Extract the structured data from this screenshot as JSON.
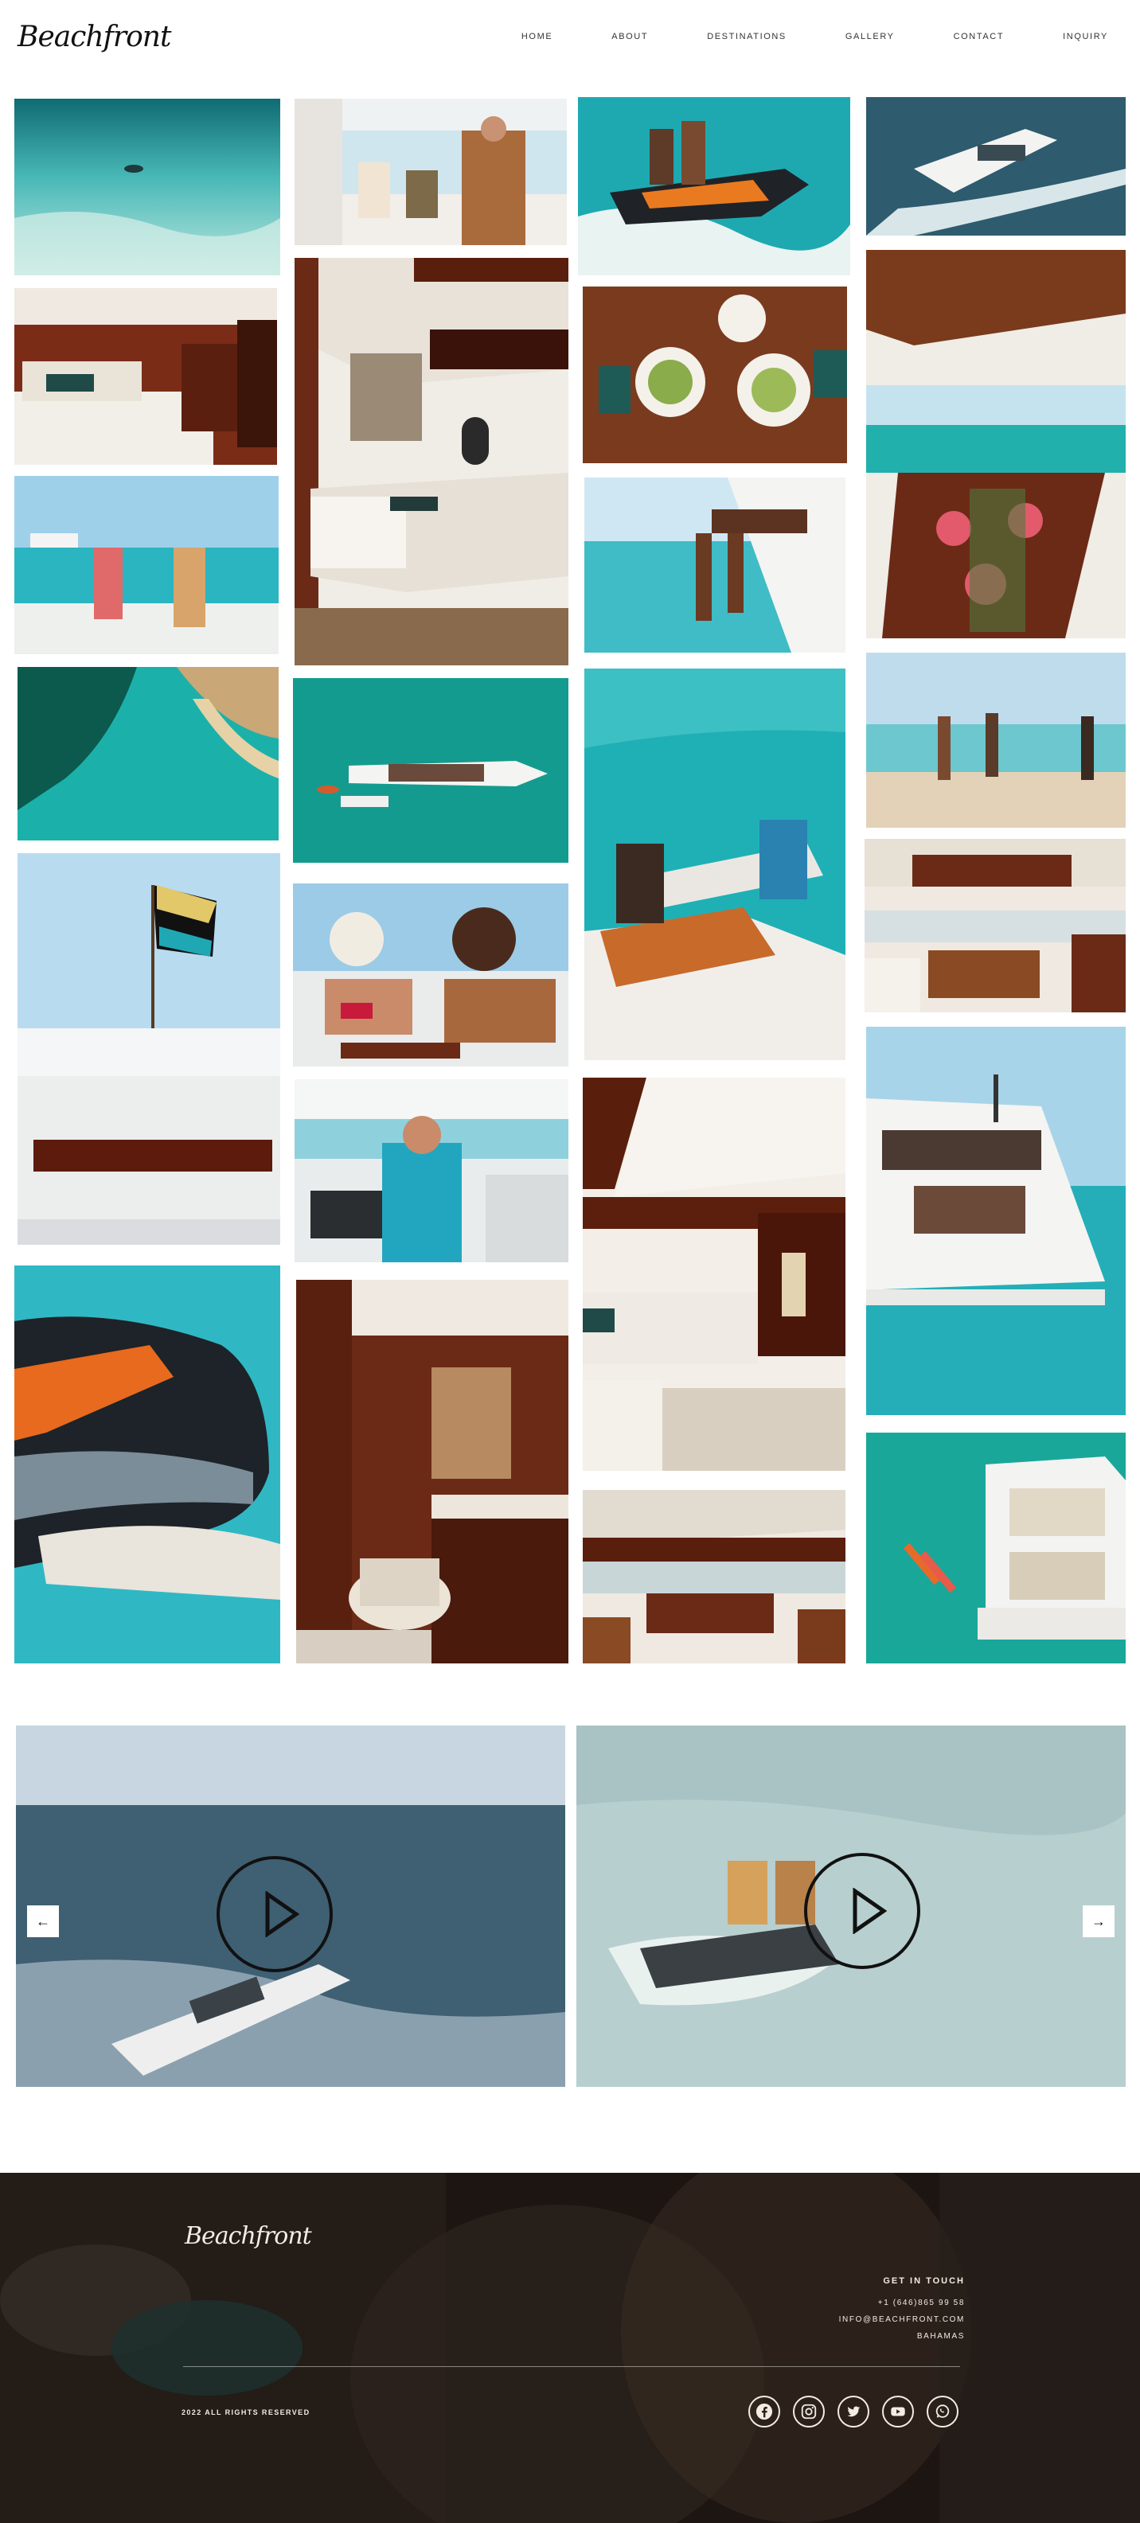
{
  "brand": {
    "name": "Beachfront"
  },
  "nav": {
    "items": [
      "HOME",
      "ABOUT",
      "DESTINATIONS",
      "GALLERY",
      "CONTACT",
      "INQUIRY"
    ]
  },
  "gallery": {
    "photos": [
      "underwater-swimmer",
      "chef-serving-guests",
      "jetski-couple",
      "yacht-wake-aerial",
      "master-cabin",
      "salon-sofa",
      "dinner-table-overhead",
      "yacht-aft-dining",
      "friends-toasting",
      "legs-over-bow",
      "sandbar-aerial",
      "yacht-aerial-teal",
      "beach-walk",
      "bahamas-flag-deck",
      "paddleboard-launch",
      "galley-kitchen",
      "women-on-sundeck",
      "yacht-stern",
      "captain-helm",
      "guest-cabin",
      "seadoo-closeup",
      "ensuite-bathroom",
      "dining-salon",
      "yacht-toys-aerial"
    ]
  },
  "videos": {
    "items": [
      "yacht-cruising-video",
      "jetski-ride-video"
    ],
    "prev_icon": "arrow-left-icon",
    "next_icon": "arrow-right-icon"
  },
  "footer": {
    "logo": "Beachfront",
    "contact_heading": "GET IN TOUCH",
    "phone": "+1 (646)865 99 58",
    "email": "INFO@BEACHFRONT.COM",
    "location": "BAHAMAS",
    "rights": "2022 ALL RIGHTS RESERVED",
    "socials": [
      "facebook-icon",
      "instagram-icon",
      "twitter-icon",
      "youtube-icon",
      "whatsapp-icon"
    ]
  },
  "colors": {
    "turquoise": "#22b3b0",
    "teal_dark": "#0f7f7a",
    "wood": "#6b2a16",
    "cream": "#efe9e1",
    "footer_text": "#f3ece2"
  }
}
